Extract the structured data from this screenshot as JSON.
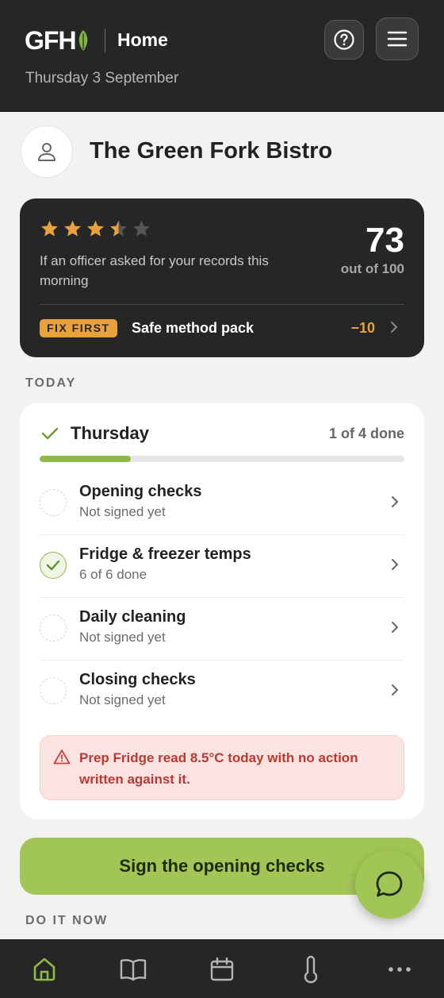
{
  "header": {
    "logo_text": "GFH",
    "title": "Home",
    "date": "Thursday 3 September",
    "help_icon": "help-circle-icon",
    "menu_icon": "hamburger-menu-icon"
  },
  "business": {
    "name": "The Green Fork Bistro",
    "avatar_icon": "user-icon"
  },
  "score": {
    "rating_stars": 3.5,
    "rating_max": 5,
    "description": "If an officer asked for your records this morning",
    "value": "73",
    "out_of": "out of 100",
    "fix": {
      "badge": "FIX FIRST",
      "label": "Safe method pack",
      "points": "−10"
    }
  },
  "today": {
    "section_label": "TODAY",
    "day": "Thursday",
    "done_text": "1 of 4 done",
    "progress": 0.25,
    "tasks": [
      {
        "title": "Opening checks",
        "status": "Not signed yet",
        "done": false
      },
      {
        "title": "Fridge & freezer temps",
        "status": "6 of 6 done",
        "done": true
      },
      {
        "title": "Daily cleaning",
        "status": "Not signed yet",
        "done": false
      },
      {
        "title": "Closing checks",
        "status": "Not signed yet",
        "done": false
      }
    ],
    "alert": "Prep Fridge read 8.5°C today with no action written against it."
  },
  "cta_label": "Sign the opening checks",
  "do_it_now_label": "DO IT NOW",
  "nav": [
    "home-icon",
    "book-icon",
    "calendar-icon",
    "thermometer-icon",
    "more-icon"
  ],
  "colors": {
    "dark": "#262626",
    "accent_green": "#a2c656",
    "star_amber": "#e9a23b",
    "alert_red": "#b83a32"
  }
}
